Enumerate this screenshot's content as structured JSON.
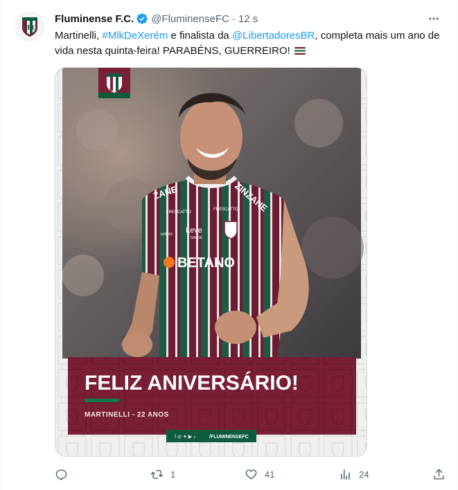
{
  "account": {
    "display_name": "Fluminense F.C.",
    "handle": "@FluminenseFC",
    "separator": "·",
    "time": "12 s"
  },
  "tweet": {
    "t1": "Martinelli, ",
    "hashtag": "#MlkDeXerém",
    "t2": " e finalista da ",
    "mention": "@LibertadoresBR",
    "t3": ", completa mais um ano de vida nesta quinta-feira! PARABÉNS, GUERREIRO! "
  },
  "media": {
    "headline": "FELIZ ANIVERSÁRIO!",
    "subline": "MARTINELLI - 22 ANOS",
    "social_handle": "/FLUMINENSEFC",
    "shirt_text_1": "ZINZANE",
    "shirt_text_2": "ZANE",
    "shirt_sponsor": "BETANO",
    "shirt_brand": "Leve",
    "shirt_brand_sub": "SAÚDE",
    "shirt_maker": "umbro",
    "patch_1": "FRESCATTO",
    "patch_2": "FRESCATTO"
  },
  "actions": {
    "replies": "",
    "retweets": "1",
    "likes": "41",
    "views": "24"
  },
  "colors": {
    "brand_maroon": "#7a1f35",
    "brand_green": "#0f5b3e",
    "link": "#1d9bf0",
    "muted": "#536471"
  },
  "icons": [
    "verified-icon",
    "more-icon",
    "reply-icon",
    "retweet-icon",
    "like-icon",
    "views-icon",
    "share-icon",
    "flag-icon"
  ]
}
